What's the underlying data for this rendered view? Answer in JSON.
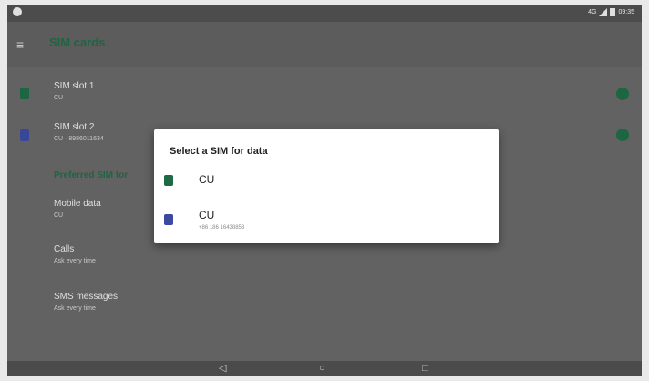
{
  "status_bar": {
    "time": "09:35",
    "battery_label": "4G",
    "icons": [
      "settings-icon",
      "wifi-icon",
      "signal-icon",
      "battery-icon"
    ]
  },
  "app_bar": {
    "back_icon": "back-arrow-icon",
    "title": "SIM cards"
  },
  "sim_list": {
    "sims": [
      {
        "name": "SIM slot 1",
        "detail": "CU",
        "icon_color": "#1e6a45",
        "enabled": true
      },
      {
        "name": "SIM slot 2",
        "detail": "CU · 8986011634",
        "icon_color": "#3b4aa0",
        "enabled": true
      }
    ],
    "section_header": "Preferred SIM for",
    "preferences": [
      {
        "title": "Mobile data",
        "value": "CU"
      },
      {
        "title": "Calls",
        "value": "Ask every time"
      },
      {
        "title": "SMS messages",
        "value": "Ask every time"
      }
    ]
  },
  "dialog": {
    "title": "Select a SIM for data",
    "options": [
      {
        "name": "CU",
        "number": "",
        "icon_color": "#1e6a45"
      },
      {
        "name": "CU",
        "number": "+86 186 16438853",
        "icon_color": "#3b4aa0"
      }
    ]
  },
  "nav_bar": {
    "back": "◁",
    "home": "○",
    "recents": "□"
  }
}
